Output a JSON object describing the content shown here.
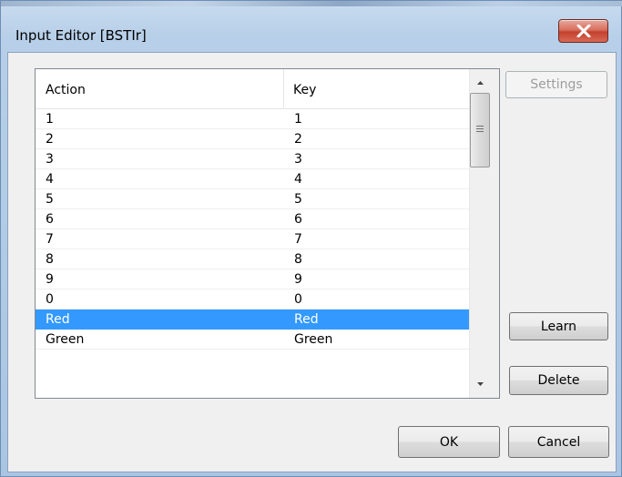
{
  "window": {
    "title": "Input Editor [BSTIr]"
  },
  "list": {
    "columns": [
      "Action",
      "Key"
    ],
    "rows": [
      {
        "action": "1",
        "key": "1"
      },
      {
        "action": "2",
        "key": "2"
      },
      {
        "action": "3",
        "key": "3"
      },
      {
        "action": "4",
        "key": "4"
      },
      {
        "action": "5",
        "key": "5"
      },
      {
        "action": "6",
        "key": "6"
      },
      {
        "action": "7",
        "key": "7"
      },
      {
        "action": "8",
        "key": "8"
      },
      {
        "action": "9",
        "key": "9"
      },
      {
        "action": "0",
        "key": "0"
      },
      {
        "action": "Red",
        "key": "Red"
      },
      {
        "action": "Green",
        "key": "Green"
      }
    ],
    "selected_row": "Red"
  },
  "buttons": {
    "settings": "Settings",
    "learn": "Learn",
    "delete": "Delete",
    "ok": "OK",
    "cancel": "Cancel"
  },
  "colors": {
    "selection": "#3399ff",
    "close_button": "#c4412e"
  },
  "icons": {
    "close": "close-icon",
    "scroll_up": "scroll-up-arrow-icon",
    "scroll_down": "scroll-down-arrow-icon"
  }
}
